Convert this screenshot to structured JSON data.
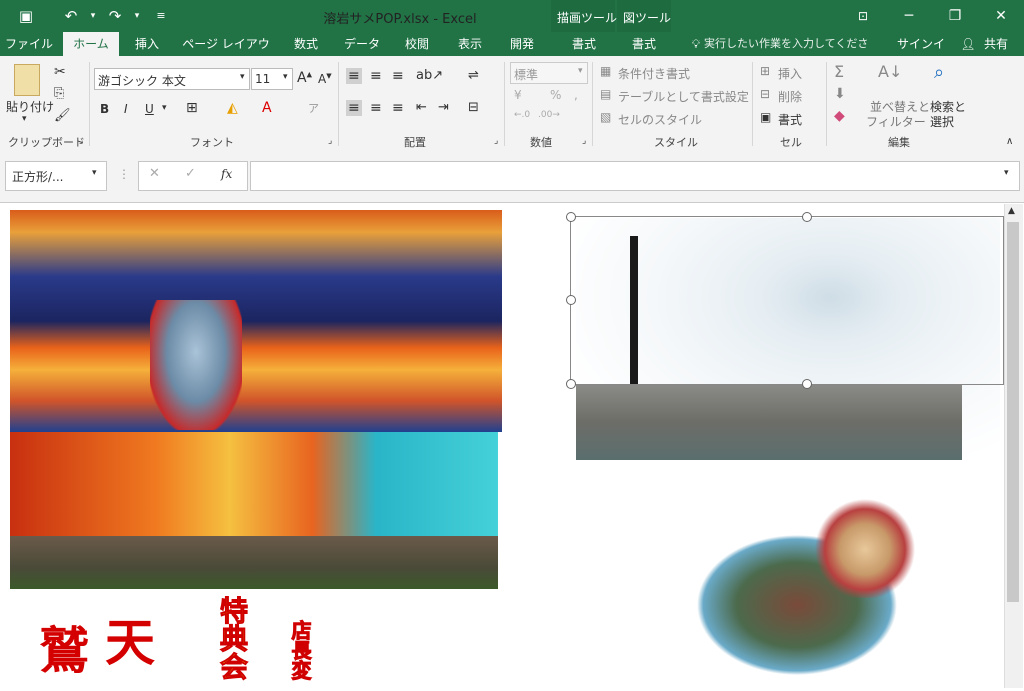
{
  "titlebar": {
    "title": "溶岩サメPOP.xlsx - Excel",
    "context_draw_tools": "描画ツール",
    "context_picture_tools": "図ツール",
    "window_controls": [
      "ribbon-display-icon",
      "minimize-icon",
      "restore-icon",
      "close-icon"
    ]
  },
  "tabs": [
    "ファイル",
    "ホーム",
    "挿入",
    "ページ レイアウト",
    "数式",
    "データ",
    "校閲",
    "表示",
    "開発",
    "書式",
    "書式"
  ],
  "active_tab": "ホーム",
  "tellme": "実行したい作業を入力してください...",
  "signin": "サインイン",
  "share": "共有",
  "ribbon": {
    "clipboard": {
      "paste": "貼り付け",
      "label": "クリップボード"
    },
    "font": {
      "font_name": "游ゴシック 本文",
      "font_size": "11",
      "bold": "B",
      "italic": "I",
      "underline": "U",
      "label": "フォント"
    },
    "alignment": {
      "label": "配置"
    },
    "number": {
      "format": "標準",
      "label": "数値",
      "percent": "%"
    },
    "styles": {
      "conditional": "条件付き書式",
      "table": "テーブルとして書式設定",
      "cell_styles": "セルのスタイル",
      "label": "スタイル"
    },
    "cells": {
      "insert": "挿入",
      "delete": "削除",
      "format": "書式",
      "label": "セル"
    },
    "editing": {
      "sort": "並べ替えと",
      "filter": "フィルター",
      "find": "検索と",
      "select": "選択",
      "label": "編集"
    }
  },
  "formula_bar": {
    "name_box": "正方形/...",
    "fx": "fx",
    "value": ""
  },
  "sheet": {
    "poster_text_1": "鷲",
    "poster_text_2": "天",
    "poster_text_3": "特典会",
    "poster_text_4": "店長変"
  }
}
